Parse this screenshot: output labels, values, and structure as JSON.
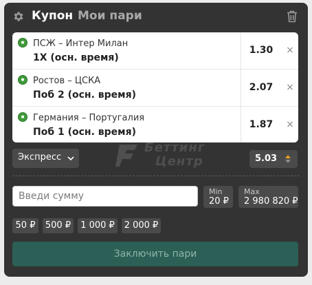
{
  "header": {
    "settings_icon": "gear-icon",
    "tab_active": "Купон",
    "tab_inactive": "Мои пари",
    "clear_icon": "trash-icon"
  },
  "bets": [
    {
      "sport_icon": "soccer-ball-icon",
      "match": "ПСЖ – Интер Милан",
      "pick": "1X (осн. время)",
      "odds": "1.30",
      "remove": "×"
    },
    {
      "sport_icon": "soccer-ball-icon",
      "match": "Ростов – ЦСКА",
      "pick": "Поб 2 (осн. время)",
      "odds": "2.07",
      "remove": "×"
    },
    {
      "sport_icon": "soccer-ball-icon",
      "match": "Германия – Португалия",
      "pick": "Поб 1 (осн. время)",
      "odds": "1.87",
      "remove": "×"
    }
  ],
  "bet_type": {
    "label": "Экспресс",
    "icon": "chevron-down-icon"
  },
  "total_odds": {
    "value": "5.03",
    "icon": "up-down-arrows-icon"
  },
  "watermark": {
    "line1": "Беттинг",
    "line2": "Центр"
  },
  "stake": {
    "placeholder": "Введи сумму",
    "value": ""
  },
  "limits": {
    "min_label": "Min",
    "min_value": "20 ₽",
    "max_label": "Max",
    "max_value": "2 980 820 ₽"
  },
  "quick_amounts": [
    "50 ₽",
    "500 ₽",
    "1 000 ₽",
    "2 000 ₽"
  ],
  "submit_label": "Заключить пари",
  "colors": {
    "panel_bg": "#333333",
    "chip_bg": "#4a4a4a",
    "submit_bg": "#2c5f55",
    "submit_text": "#8db5ad",
    "odds_up": "#e6a020",
    "ball_green": "#3f9a3a"
  }
}
